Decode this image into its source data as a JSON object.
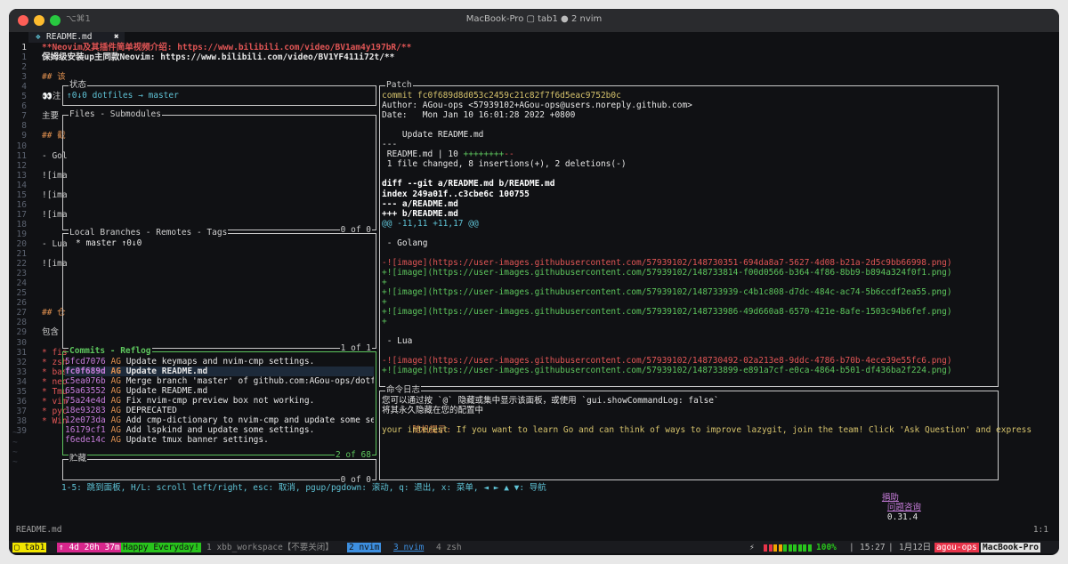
{
  "window": {
    "title": "MacBook-Pro ▢ tab1 ● 2 nvim",
    "shortcut": "⌥⌘1"
  },
  "nvim": {
    "tab": {
      "icon": "❖",
      "name": "README.md",
      "close": "✖"
    },
    "lines": [
      {
        "n": "1",
        "cur": true,
        "t": "**Neovim及其插件简单视频介绍: https://www.bilibili.com/video/BV1am4y197bR/**"
      },
      {
        "n": "1",
        "t": "保姆级安装up主同款Neovim: https://www.bilibili.com/video/BV1YF411i72t/**"
      },
      {
        "n": "2",
        "t": ""
      },
      {
        "n": "3",
        "t": "## 该"
      },
      {
        "n": "4",
        "t": ""
      },
      {
        "n": "5",
        "t": "👀注"
      },
      {
        "n": "6",
        "t": ""
      },
      {
        "n": "7",
        "t": "主要"
      },
      {
        "n": "8",
        "t": ""
      },
      {
        "n": "9",
        "t": "## 截"
      },
      {
        "n": "10",
        "t": ""
      },
      {
        "n": "11",
        "t": "- Gol"
      },
      {
        "n": "12",
        "t": ""
      },
      {
        "n": "13",
        "t": "![ima"
      },
      {
        "n": "14",
        "t": ""
      },
      {
        "n": "15",
        "t": "![ima"
      },
      {
        "n": "16",
        "t": ""
      },
      {
        "n": "17",
        "t": "![ima"
      },
      {
        "n": "18",
        "t": ""
      },
      {
        "n": "19",
        "t": ""
      },
      {
        "n": "20",
        "t": "- Lua"
      },
      {
        "n": "21",
        "t": ""
      },
      {
        "n": "22",
        "t": "![ima"
      },
      {
        "n": "23",
        "t": ""
      },
      {
        "n": "24",
        "t": ""
      },
      {
        "n": "25",
        "t": ""
      },
      {
        "n": "26",
        "t": ""
      },
      {
        "n": "27",
        "t": "## 仓"
      },
      {
        "n": "28",
        "t": ""
      },
      {
        "n": "29",
        "t": "包含"
      },
      {
        "n": "30",
        "t": ""
      },
      {
        "n": "31",
        "t": "* fis"
      },
      {
        "n": "32",
        "t": "* zsh"
      },
      {
        "n": "33",
        "t": "* bas"
      },
      {
        "n": "34",
        "t": "* neo"
      },
      {
        "n": "35",
        "t": "* Tmu"
      },
      {
        "n": "36",
        "t": "* vim"
      },
      {
        "n": "37",
        "t": "* pyc"
      },
      {
        "n": "38",
        "t": "* Win"
      },
      {
        "n": "39",
        "t": ""
      }
    ],
    "statusline": {
      "file": "README.md",
      "pos": "1:1"
    }
  },
  "lazygit": {
    "status": {
      "title": "状态",
      "text": "↑0↓0 dotfiles → master"
    },
    "files": {
      "title": "Files - Submodules",
      "count": "0 of 0"
    },
    "branches": {
      "title": "Local Branches - Remotes - Tags",
      "item": "* master ↑0↓0",
      "count": "1 of 1"
    },
    "commits": {
      "title": "Commits - Reflog",
      "count": "2 of 68",
      "items": [
        {
          "hash": "5fcd7076",
          "author": "AG",
          "msg": "Update keymaps and nvim-cmp settings.",
          "sel": false
        },
        {
          "hash": "fc0f689d",
          "author": "AG",
          "msg": "Update README.md",
          "sel": true
        },
        {
          "hash": "c5ea076b",
          "author": "AG",
          "msg": "Merge branch 'master' of github.com:AGou-ops/dotfi",
          "sel": false
        },
        {
          "hash": "65a63552",
          "author": "AG",
          "msg": "Update README.md",
          "sel": false
        },
        {
          "hash": "75a24e4d",
          "author": "AG",
          "msg": "Fix nvim-cmp preview box not working.",
          "sel": false
        },
        {
          "hash": "18e93283",
          "author": "AG",
          "msg": "DEPRECATED",
          "sel": false
        },
        {
          "hash": "12e073da",
          "author": "AG",
          "msg": "Add cmp-dictionary to nvim-cmp and update some set",
          "sel": false
        },
        {
          "hash": "16179cf1",
          "author": "AG",
          "msg": "Add lspkind and update some settings.",
          "sel": false
        },
        {
          "hash": "f6ede14c",
          "author": "AG",
          "msg": "Update tmux banner settings.",
          "sel": false
        }
      ]
    },
    "stash": {
      "title": "贮藏",
      "count": "0 of 0"
    },
    "patch": {
      "title": "Patch",
      "lines": [
        {
          "c": "yellow",
          "t": "commit fc0f689d8d053c2459c21c82f7f6d5eac9752b0c"
        },
        {
          "c": "white",
          "t": "Author: AGou-ops <57939102+AGou-ops@users.noreply.github.com>"
        },
        {
          "c": "white",
          "t": "Date:   Mon Jan 10 16:01:28 2022 +0800"
        },
        {
          "c": "white",
          "t": ""
        },
        {
          "c": "white",
          "t": "    Update README.md"
        },
        {
          "c": "white",
          "t": "---"
        },
        {
          "c": "white",
          "t": " README.md | 10 ++++++++--"
        },
        {
          "c": "white",
          "t": " 1 file changed, 8 insertions(+), 2 deletions(-)"
        },
        {
          "c": "white",
          "t": ""
        },
        {
          "c": "boldwhite",
          "t": "diff --git a/README.md b/README.md"
        },
        {
          "c": "boldwhite",
          "t": "index 249a01f..c3cbe6c 100755"
        },
        {
          "c": "boldwhite",
          "t": "--- a/README.md"
        },
        {
          "c": "boldwhite",
          "t": "+++ b/README.md"
        },
        {
          "c": "cyan",
          "t": "@@ -11,11 +11,17 @@"
        },
        {
          "c": "white",
          "t": ""
        },
        {
          "c": "white",
          "t": " - Golang"
        },
        {
          "c": "white",
          "t": ""
        },
        {
          "c": "red",
          "t": "-![image](https://user-images.githubusercontent.com/57939102/148730351-694da8a7-5627-4d08-b21a-2d5c9bb66998.png)"
        },
        {
          "c": "green",
          "t": "+![image](https://user-images.githubusercontent.com/57939102/148733814-f00d0566-b364-4f86-8bb9-b894a324f0f1.png)"
        },
        {
          "c": "green",
          "t": "+"
        },
        {
          "c": "green",
          "t": "+![image](https://user-images.githubusercontent.com/57939102/148733939-c4b1c808-d7dc-484c-ac74-5b6ccdf2ea55.png)"
        },
        {
          "c": "green",
          "t": "+"
        },
        {
          "c": "green",
          "t": "+![image](https://user-images.githubusercontent.com/57939102/148733986-49d660a8-6570-421e-8afe-1503c94b6fef.png)"
        },
        {
          "c": "green",
          "t": "+"
        },
        {
          "c": "white",
          "t": ""
        },
        {
          "c": "white",
          "t": " - Lua"
        },
        {
          "c": "white",
          "t": ""
        },
        {
          "c": "red",
          "t": "-![image](https://user-images.githubusercontent.com/57939102/148730492-02a213e8-9ddc-4786-b70b-4ece39e55fc6.png)"
        },
        {
          "c": "green",
          "t": "+![image](https://user-images.githubusercontent.com/57939102/148733899-e891a7cf-e0ca-4864-b501-df436ba2f224.png)"
        }
      ]
    },
    "cmdlog": {
      "title": "命令日志",
      "line1": "您可以通过按 `@` 隐藏或集中显示该面板，或使用 `gui.showCommandLog: false`",
      "line2": "将其永久隐藏在您的配置中",
      "tip_label": "随机提示:",
      "tip": " If you want to learn Go and can think of ways to improve lazygit, join the team! Click 'Ask Question' and express",
      "tip2": "your interest"
    },
    "footer": {
      "help": "1-5: 跳到面板, H/L: scroll left/right, esc: 取消, pgup/pgdown: 滚动, q: 退出, x: 菜单, ◄ ► ▲ ▼: 导航",
      "donate": "捐助",
      "ask": "问题咨询",
      "version": "0.31.4"
    }
  },
  "tmux": {
    "session": "▢ tab1",
    "uptime": "↑ 4d 20h 37m",
    "greeting": "Happy Everyday!",
    "win1": "1 xbb_workspace【不要关闭】",
    "win2": "2 nvim",
    "win3": "3 nvim",
    "win4": "4 zsh",
    "battery_icon": "⚡",
    "battery": "100%",
    "time": "15:27",
    "date": "1月12日",
    "user": "agou-ops",
    "host": "MacBook-Pro",
    "colors": {
      "session": "#f2e600",
      "uptime": "#d7268c",
      "greeting": "#28c41c",
      "win2": "#3d8fe0",
      "user": "#e8344a",
      "host": "#e0e0e0"
    }
  }
}
